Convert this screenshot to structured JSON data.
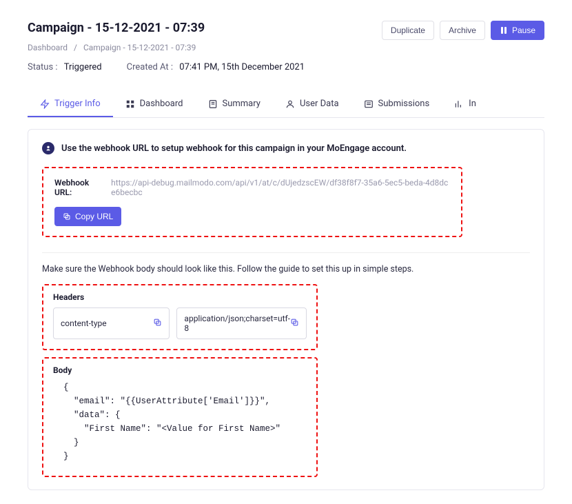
{
  "header": {
    "title": "Campaign - 15-12-2021 - 07:39",
    "duplicate": "Duplicate",
    "archive": "Archive",
    "pause": "Pause"
  },
  "breadcrumb": {
    "root": "Dashboard",
    "current": "Campaign - 15-12-2021 - 07:39"
  },
  "meta": {
    "status_label": "Status :",
    "status_value": "Triggered",
    "created_label": "Created At :",
    "created_value": "07:41 PM, 15th December 2021"
  },
  "tabs": {
    "trigger": "Trigger Info",
    "dashboard": "Dashboard",
    "summary": "Summary",
    "userdata": "User Data",
    "submissions": "Submissions",
    "insights": "In"
  },
  "callout": "Use the webhook URL to setup webhook for this campaign in your MoEngage account.",
  "webhook": {
    "label": "Webhook URL:",
    "value": "https://api-debug.mailmodo.com/api/v1/at/c/dUjedzscEW/df38f8f7-35a6-5ec5-beda-4d8dce6becbc",
    "copy": "Copy URL"
  },
  "hint": "Make sure the Webhook body should look like this. Follow the guide to set this up in simple steps.",
  "headers": {
    "label": "Headers",
    "key": "content-type",
    "value": "application/json;charset=utf-8"
  },
  "body": {
    "label": "Body",
    "code": "  {\n    \"email\": \"{{UserAttribute['Email']}}\",\n    \"data\": {\n      \"First Name\": \"<Value for First Name>\"\n    }\n  }"
  }
}
